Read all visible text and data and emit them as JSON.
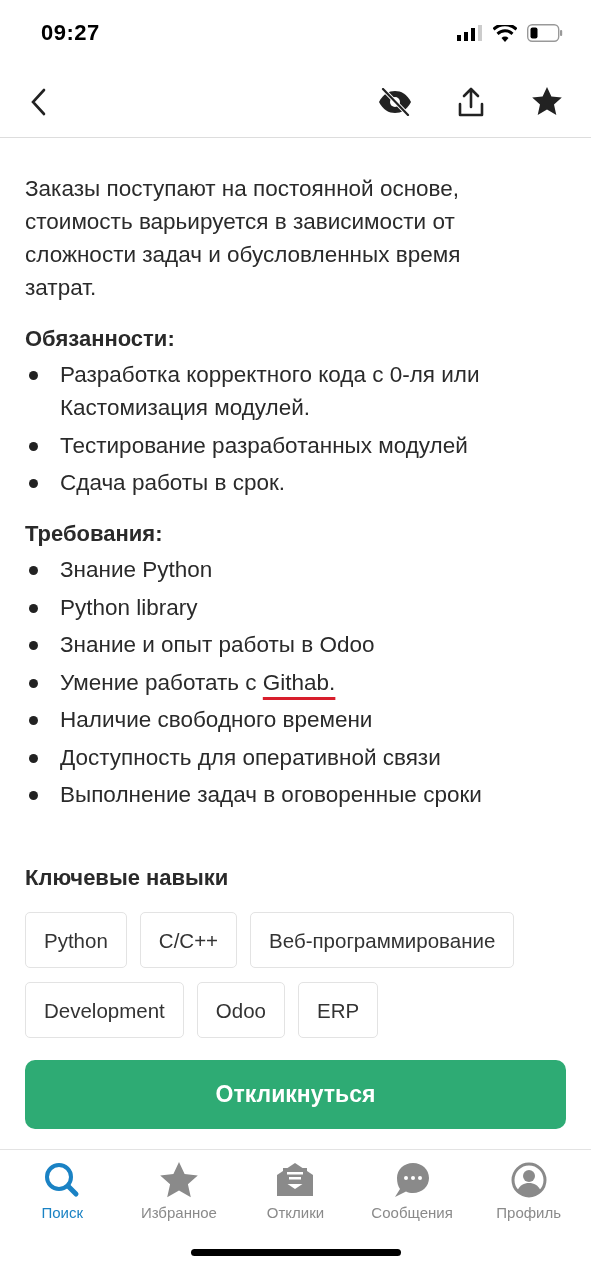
{
  "status_bar": {
    "time": "09:27"
  },
  "description": {
    "paragraph": "Заказы поступают на постоянной основе, стоимость варьируется в зависимости от сложности задач и обусловленных время затрат."
  },
  "sections": [
    {
      "heading": "Обязанности:",
      "items": [
        {
          "text": "Разработка корректного кода с 0-ля или Кастомизация модулей."
        },
        {
          "text": "Тестирование разработанных модулей"
        },
        {
          "text": "Сдача работы в срок."
        }
      ]
    },
    {
      "heading": "Требования:",
      "items": [
        {
          "text": "Знание Python"
        },
        {
          "text": "Python library"
        },
        {
          "text": "Знание и опыт работы в Odoo"
        },
        {
          "text": "Умение работать с ",
          "underlined": "Githab."
        },
        {
          "text": "Наличие свободного времени"
        },
        {
          "text": "Доступность для оперативной связи"
        },
        {
          "text": "Выполнение задач в оговоренные сроки"
        }
      ]
    }
  ],
  "skills": {
    "title": "Ключевые навыки",
    "tags": [
      "Python",
      "C/C++",
      "Веб-программирование",
      "Development",
      "Odoo",
      "ERP"
    ]
  },
  "respond_button": "Откликнуться",
  "tab_bar": [
    {
      "label": "Поиск",
      "selected": true
    },
    {
      "label": "Избранное",
      "selected": false
    },
    {
      "label": "Отклики",
      "selected": false
    },
    {
      "label": "Сообщения",
      "selected": false
    },
    {
      "label": "Профиль",
      "selected": false
    }
  ]
}
